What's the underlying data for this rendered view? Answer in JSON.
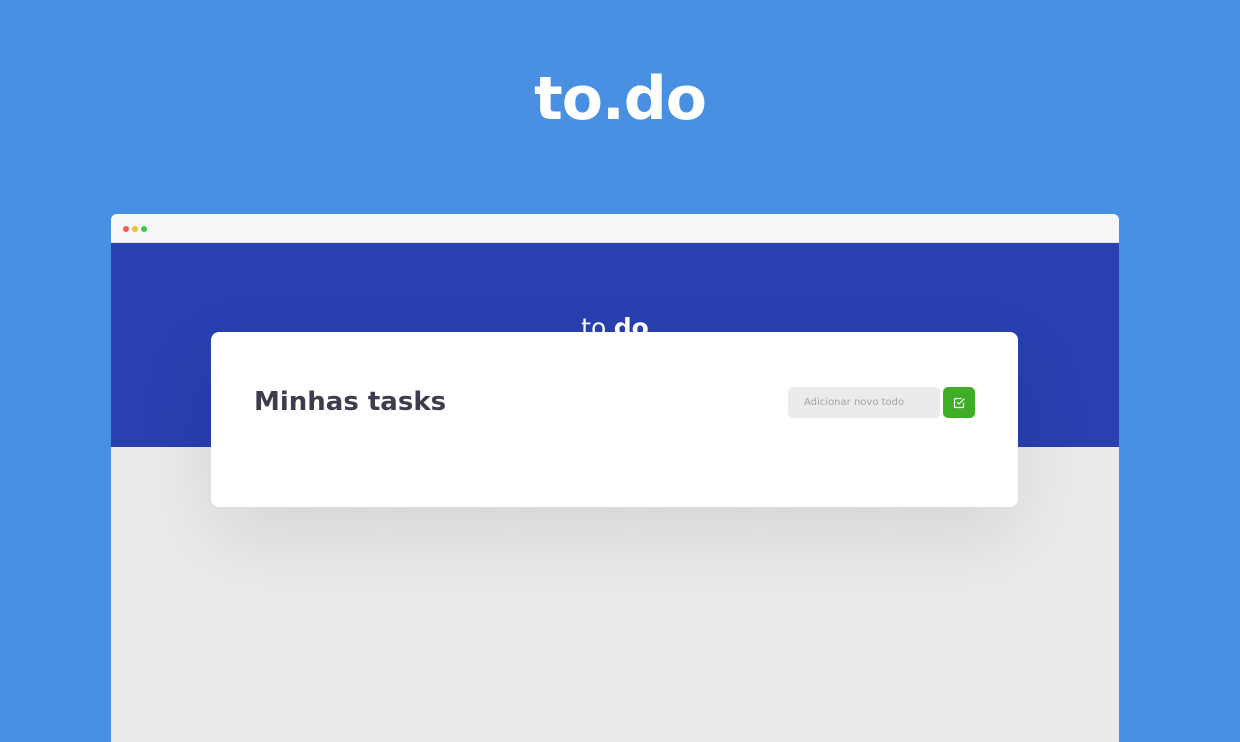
{
  "hero": {
    "title": "to.do"
  },
  "browser": {
    "window_dots": [
      "close",
      "minimize",
      "maximize"
    ]
  },
  "app": {
    "logo_light": "to.",
    "logo_bold": "do",
    "card_title": "Minhas tasks",
    "input_placeholder": "Adicionar novo todo",
    "input_value": "",
    "add_button_icon": "checkbox-icon"
  },
  "colors": {
    "background": "#4a90e2",
    "header": "#2840b0",
    "accent_button": "#3fad26",
    "content_bg": "#ebebeb"
  }
}
